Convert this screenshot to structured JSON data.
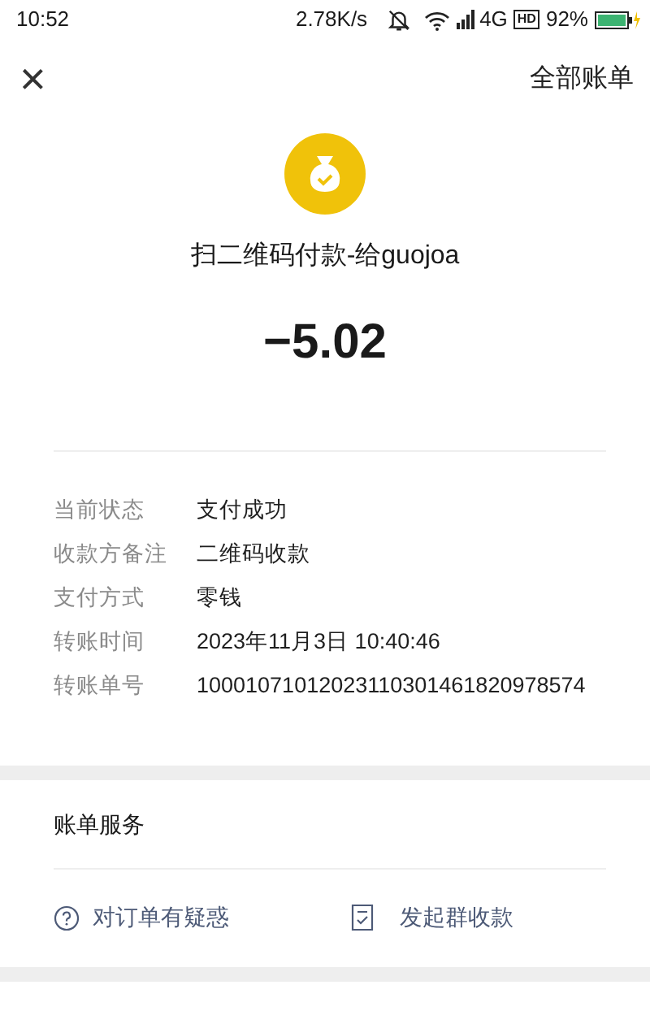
{
  "status_bar": {
    "time": "10:52",
    "speed": "2.78K/s",
    "network": "4G",
    "hd": "HD",
    "battery": "92%"
  },
  "header": {
    "close": "×",
    "action": "全部账单"
  },
  "payment": {
    "title": "扫二维码付款-给guojoa",
    "amount": "−5.02"
  },
  "details": [
    {
      "label": "当前状态",
      "value": "支付成功"
    },
    {
      "label": "收款方备注",
      "value": "二维码收款"
    },
    {
      "label": "支付方式",
      "value": "零钱"
    },
    {
      "label": "转账时间",
      "value": "2023年11月3日 10:40:46"
    },
    {
      "label": "转账单号",
      "value": "10001071012023110301461820978574"
    }
  ],
  "services": {
    "title": "账单服务",
    "actions": [
      {
        "kind": "question",
        "label": "对订单有疑惑"
      },
      {
        "kind": "receipt",
        "label": "发起群收款"
      }
    ]
  }
}
